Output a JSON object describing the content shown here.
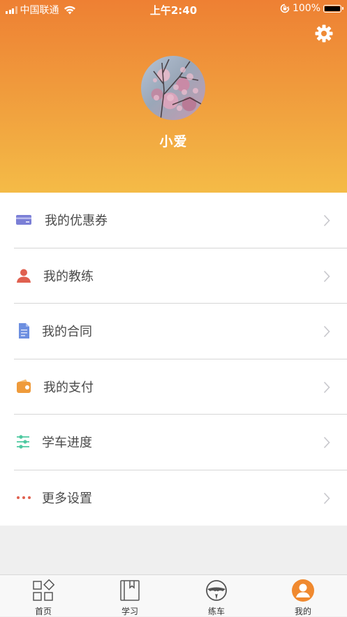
{
  "status_bar": {
    "carrier": "中国联通",
    "time": "上午2:40",
    "battery": "100%"
  },
  "profile": {
    "username": "小爱"
  },
  "menu": {
    "items": [
      {
        "label": "我的优惠券",
        "icon": "card-icon",
        "color": "#7b7fd6"
      },
      {
        "label": "我的教练",
        "icon": "person-icon",
        "color": "#e0604f"
      },
      {
        "label": "我的合同",
        "icon": "document-icon",
        "color": "#6d8fe0"
      },
      {
        "label": "我的支付",
        "icon": "wallet-icon",
        "color": "#ef9b3b"
      },
      {
        "label": "学车进度",
        "icon": "sliders-icon",
        "color": "#4ec9a0"
      },
      {
        "label": "更多设置",
        "icon": "more-dots-icon",
        "color": "#e0604f"
      }
    ]
  },
  "tabbar": {
    "tabs": [
      {
        "label": "首页",
        "icon": "grid-icon"
      },
      {
        "label": "学习",
        "icon": "book-icon"
      },
      {
        "label": "练车",
        "icon": "steering-wheel-icon"
      },
      {
        "label": "我的",
        "icon": "user-avatar-icon",
        "active": true
      }
    ],
    "active_color": "#f0892f"
  },
  "colors": {
    "header_top": "#ee8033",
    "header_bottom": "#f4bb47",
    "background": "#efefef"
  }
}
